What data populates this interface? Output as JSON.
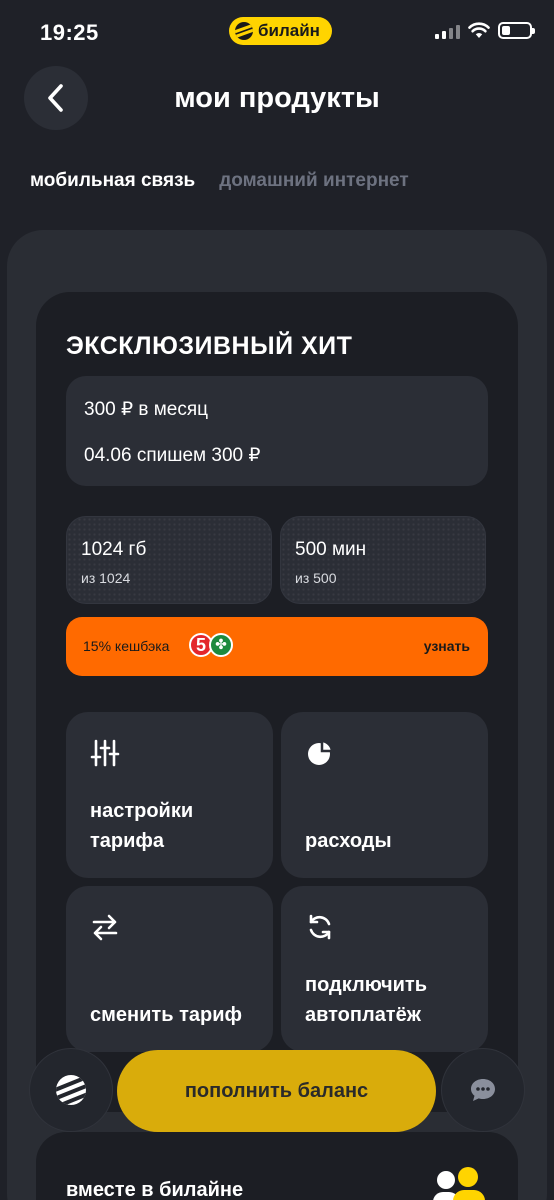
{
  "status_bar": {
    "time": "19:25",
    "carrier": "билайн"
  },
  "header": {
    "title": "мои продукты",
    "back_icon": "chevron-left-icon"
  },
  "tabs": [
    {
      "label": "мобильная связь",
      "active": true
    },
    {
      "label": "домашний интернет",
      "active": false
    }
  ],
  "tariff": {
    "name": "ЭКСКЛЮЗИВНЫЙ ХИТ",
    "price_line": "300 ₽ в месяц",
    "charge_line": "04.06 спишем 300 ₽",
    "quotas": [
      {
        "value": "1024 гб",
        "sub": "из 1024"
      },
      {
        "value": "500 мин",
        "sub": "из 500"
      }
    ],
    "cashback": {
      "text": "15% кешбэка",
      "logo_digit": "5",
      "link": "узнать"
    },
    "actions": [
      {
        "label": "настройки тарифа",
        "icon": "sliders-icon"
      },
      {
        "label": "расходы",
        "icon": "pie-chart-icon"
      },
      {
        "label": "сменить тариф",
        "icon": "swap-arrows-icon"
      },
      {
        "label": "подключить автоплатёж",
        "icon": "refresh-icon"
      }
    ]
  },
  "floating": {
    "topup_label": "пополнить баланс"
  },
  "together": {
    "title": "вместе в билайне"
  },
  "colors": {
    "background": "#1f2128",
    "panel": "#2a2d34",
    "card": "#1c1e24",
    "tile": "#2b2e36",
    "brand_yellow": "#ffd400",
    "topup_yellow": "#d9ac0b",
    "cashback_orange": "#ff6a00",
    "muted_text": "#6d7280"
  }
}
